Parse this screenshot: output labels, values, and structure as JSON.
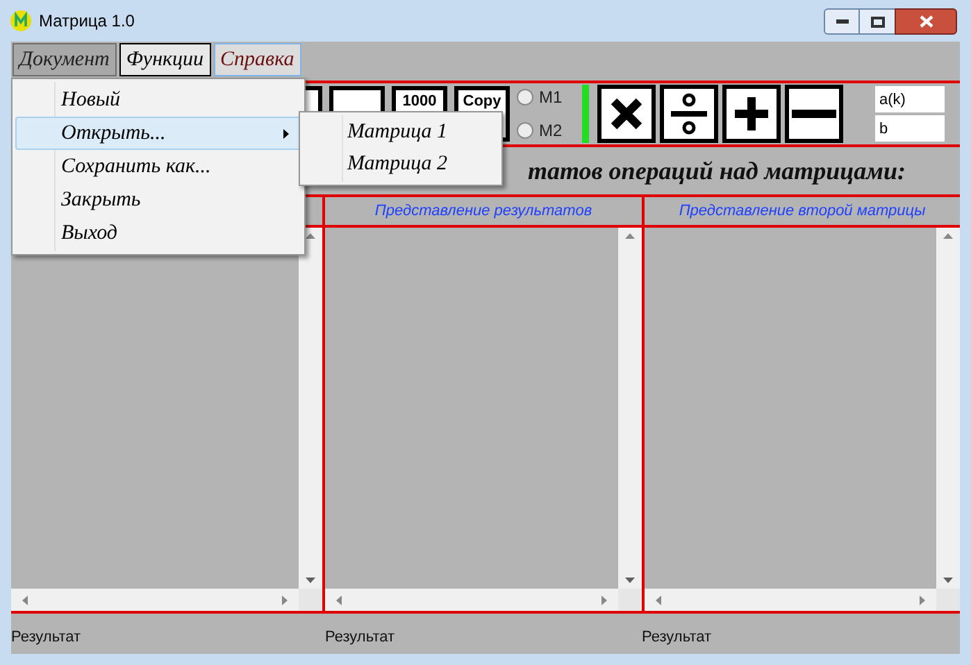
{
  "window": {
    "title": "Матрица 1.0"
  },
  "menu_bar": [
    {
      "label": "Документ",
      "selected": true
    },
    {
      "label": "Функции",
      "selected": false
    },
    {
      "label": "Справка",
      "selected": false
    }
  ],
  "toolbar": {
    "buttons": [
      "1000",
      "Copy"
    ],
    "radios": [
      {
        "label": "M1",
        "selected": false
      },
      {
        "label": "M2",
        "selected": false
      }
    ],
    "fields": [
      {
        "value": "a(k)"
      },
      {
        "value": "b"
      }
    ]
  },
  "heading": "татов операций над матрицами:",
  "panels": [
    {
      "status": "Результат"
    },
    {
      "header": "Представление результатов",
      "status": "Результат"
    },
    {
      "header": "Представление второй матрицы",
      "status": "Результат"
    }
  ],
  "dropdown": {
    "items": [
      {
        "label": "Новый",
        "selected": false,
        "kind": "item"
      },
      {
        "label": "Открыть...",
        "selected": true,
        "kind": "submenu"
      },
      {
        "label": "Сохранить как...",
        "selected": false,
        "kind": "item"
      },
      {
        "label": "Закрыть",
        "selected": false,
        "kind": "item"
      },
      {
        "label": "Выход",
        "selected": false,
        "kind": "item"
      }
    ]
  },
  "submenu": {
    "items": [
      {
        "label": "Матрица 1"
      },
      {
        "label": "Матрица 2"
      }
    ]
  }
}
